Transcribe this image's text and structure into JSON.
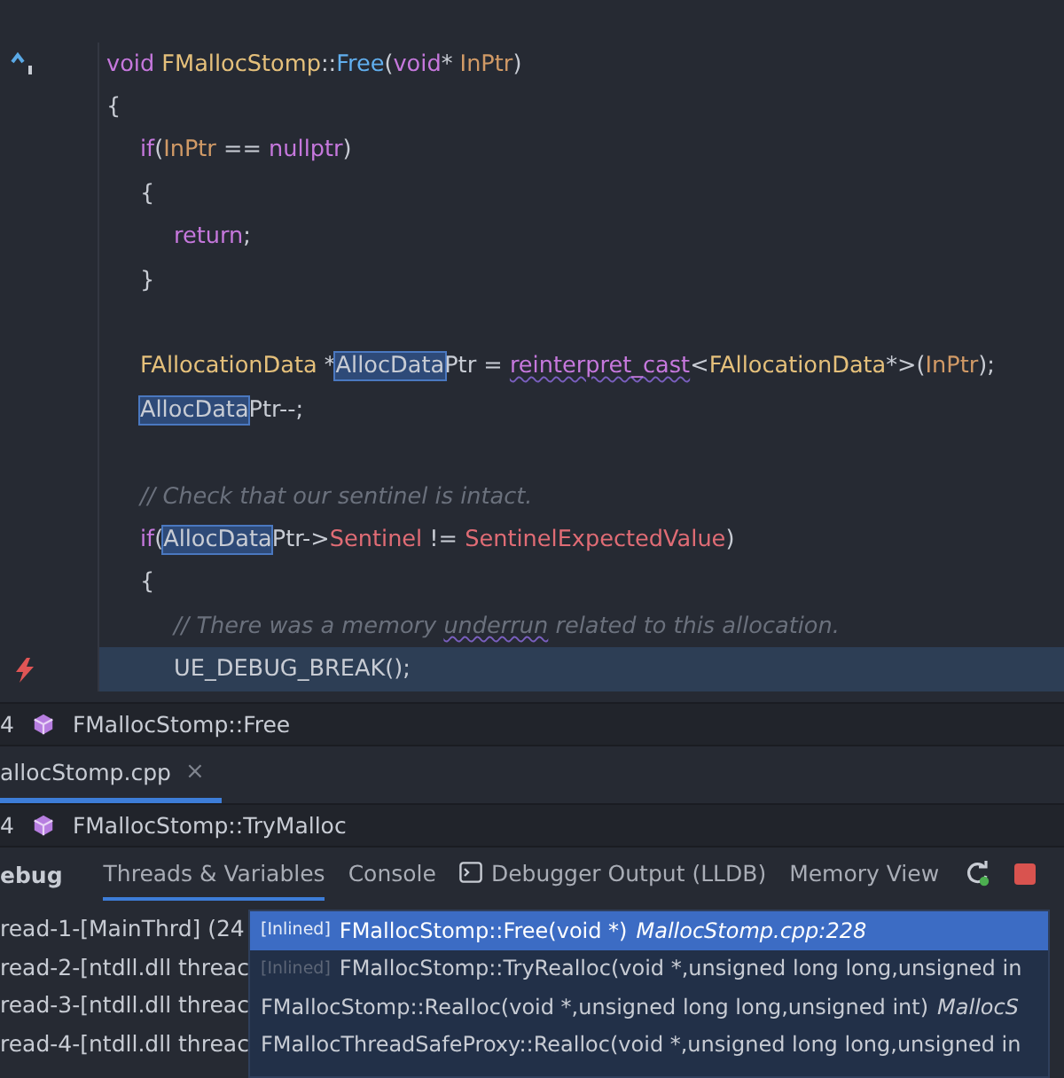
{
  "editor": {
    "lines": [
      {
        "kind": "code",
        "implemented": true,
        "segments": [
          {
            "kind": "keyword",
            "text": "void"
          },
          {
            "kind": "type",
            "text": " FMallocStomp"
          },
          {
            "kind": "plain",
            "text": "::"
          },
          {
            "kind": "func",
            "text": "Free"
          },
          {
            "kind": "plain",
            "text": "("
          },
          {
            "kind": "keyword",
            "text": "void"
          },
          {
            "kind": "plain",
            "text": "* "
          },
          {
            "kind": "param",
            "text": "InPtr"
          },
          {
            "kind": "plain",
            "text": ")"
          }
        ]
      },
      {
        "kind": "code",
        "segments": [
          {
            "kind": "plain",
            "text": "{"
          }
        ],
        "children": [
          {
            "kind": "code",
            "segments": [
              {
                "kind": "keyword",
                "text": "if"
              },
              {
                "kind": "plain",
                "text": "("
              },
              {
                "kind": "param",
                "text": "InPtr"
              },
              {
                "kind": "plain",
                "text": " == "
              },
              {
                "kind": "keyword",
                "text": "nullptr"
              },
              {
                "kind": "plain",
                "text": ")"
              }
            ]
          },
          {
            "kind": "code",
            "segments": [
              {
                "kind": "plain",
                "text": "{"
              }
            ],
            "children": [
              {
                "kind": "code",
                "segments": [
                  {
                    "kind": "keyword",
                    "text": "return"
                  },
                  {
                    "kind": "plain",
                    "text": ";"
                  }
                ]
              }
            ]
          },
          {
            "kind": "code",
            "segments": [
              {
                "kind": "plain",
                "text": "}"
              }
            ]
          },
          {
            "kind": "blank"
          },
          {
            "kind": "code",
            "segments": [
              {
                "kind": "type",
                "text": "FAllocationData"
              },
              {
                "kind": "plain",
                "text": " *"
              },
              {
                "kind": "match",
                "text": "AllocData"
              },
              {
                "kind": "plain",
                "text": "Ptr = "
              },
              {
                "kind": "squiggle",
                "text": "reinterpret_cast"
              },
              {
                "kind": "plain",
                "text": "<"
              },
              {
                "kind": "type",
                "text": "FAllocationData"
              },
              {
                "kind": "plain",
                "text": "*>("
              },
              {
                "kind": "param",
                "text": "InPtr"
              },
              {
                "kind": "plain",
                "text": ");"
              }
            ]
          },
          {
            "kind": "code",
            "segments": [
              {
                "kind": "match",
                "text": "AllocData"
              },
              {
                "kind": "plain",
                "text": "Ptr--;"
              }
            ]
          },
          {
            "kind": "blank"
          },
          {
            "kind": "code",
            "segments": [
              {
                "kind": "comment",
                "text": "// Check that our sentinel is intact."
              }
            ]
          },
          {
            "kind": "code",
            "segments": [
              {
                "kind": "keyword",
                "text": "if"
              },
              {
                "kind": "plain",
                "text": "("
              },
              {
                "kind": "match",
                "text": "AllocData"
              },
              {
                "kind": "plain",
                "text": "Ptr->"
              },
              {
                "kind": "field",
                "text": "Sentinel"
              },
              {
                "kind": "plain",
                "text": " != "
              },
              {
                "kind": "field",
                "text": "SentinelExpectedValue"
              },
              {
                "kind": "plain",
                "text": ")"
              }
            ]
          },
          {
            "kind": "code",
            "segments": [
              {
                "kind": "plain",
                "text": "{"
              }
            ],
            "children": [
              {
                "kind": "code",
                "segments": [
                  {
                    "kind": "comment",
                    "text": "// There was a memory "
                  },
                  {
                    "kind": "comment-squiggle",
                    "text": "underrun"
                  },
                  {
                    "kind": "comment",
                    "text": " related to this allocation."
                  }
                ]
              },
              {
                "kind": "code",
                "breakpoint": true,
                "current": true,
                "segments": [
                  {
                    "kind": "plain",
                    "text": "UE_DEBUG_BREAK();"
                  }
                ]
              }
            ]
          }
        ]
      }
    ]
  },
  "breadcrumb_top": {
    "line": "4",
    "symbol": "FMallocStomp::Free"
  },
  "file_tab": {
    "label": "allocStomp.cpp",
    "close": "×",
    "selected": true
  },
  "breadcrumb_bottom": {
    "line": "4",
    "symbol": "FMallocStomp::TryMalloc"
  },
  "debug": {
    "title": "ebug",
    "tabs": [
      {
        "label": "Threads & Variables",
        "selected": true
      },
      {
        "label": "Console",
        "selected": false
      },
      {
        "label": "Debugger Output (LLDB)",
        "selected": false,
        "has_icon": true
      },
      {
        "label": "Memory View",
        "selected": false
      }
    ],
    "threads": [
      "read-1-[MainThrd] (24",
      "read-2-[ntdll.dll threac",
      "read-3-[ntdll.dll threac",
      "read-4-[ntdll.dll threac"
    ],
    "frames": [
      {
        "selected": true,
        "badge": "[Inlined]",
        "badge_dim": false,
        "func": "FMallocStomp::Free(void *)",
        "file": "MallocStomp.cpp:228"
      },
      {
        "selected": false,
        "badge": "[Inlined]",
        "badge_dim": true,
        "func": "FMallocStomp::TryRealloc(void *,unsigned long long,unsigned in"
      },
      {
        "selected": false,
        "func": "FMallocStomp::Realloc(void *,unsigned long long,unsigned int)",
        "file": "MallocS"
      },
      {
        "selected": false,
        "func": "FMallocThreadSafeProxy::Realloc(void *,unsigned long long,unsigned in"
      }
    ]
  }
}
